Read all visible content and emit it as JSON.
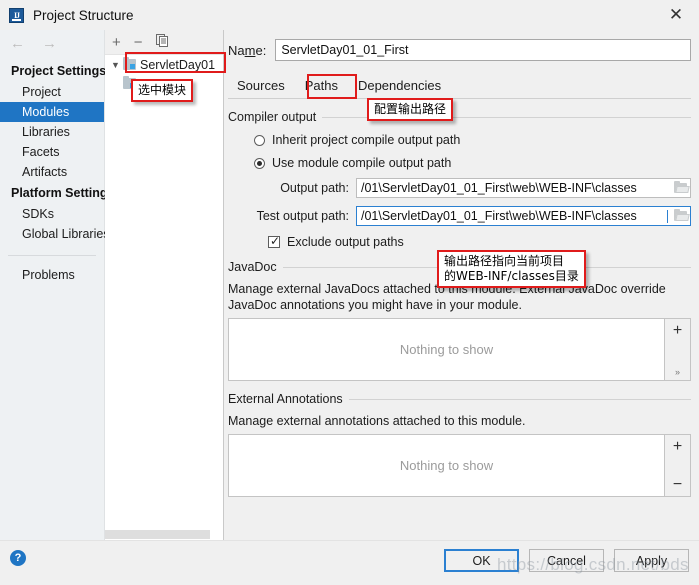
{
  "window": {
    "title": "Project Structure",
    "app_icon": "idea-icon",
    "close_icon": "✕"
  },
  "nav": {
    "back_icon": "←",
    "forward_icon": "→"
  },
  "sidebar": {
    "groups": [
      {
        "label": "Project Settings",
        "items": [
          {
            "label": "Project",
            "selected": false
          },
          {
            "label": "Modules",
            "selected": true
          },
          {
            "label": "Libraries",
            "selected": false
          },
          {
            "label": "Facets",
            "selected": false
          },
          {
            "label": "Artifacts",
            "selected": false
          }
        ]
      },
      {
        "label": "Platform Settings",
        "items": [
          {
            "label": "SDKs",
            "selected": false
          },
          {
            "label": "Global Libraries",
            "selected": false
          }
        ]
      }
    ],
    "problems_label": "Problems"
  },
  "tree": {
    "toolbar": {
      "add_label": "+",
      "remove_label": "−",
      "copy_label": "copy-icon"
    },
    "nodes": [
      {
        "label": "ServletDay01",
        "expanded": true,
        "selected": false
      }
    ]
  },
  "main": {
    "name_field": {
      "label": "Name:",
      "label_mnemonic": "m",
      "value": "ServletDay01_01_First"
    },
    "tabs": [
      {
        "label": "Sources",
        "active": false
      },
      {
        "label": "Paths",
        "active": true
      },
      {
        "label": "Dependencies",
        "active": false
      }
    ],
    "compiler_output": {
      "group_title": "Compiler output",
      "inherit_option": "Inherit project compile output path",
      "module_option": "Use module compile output path",
      "selected_option": "module",
      "output_path_label": "Output path:",
      "output_path_value": "/01\\ServletDay01_01_First\\web\\WEB-INF\\classes",
      "test_output_path_label": "Test output path:",
      "test_output_path_value": "/01\\ServletDay01_01_First\\web\\WEB-INF\\classes",
      "exclude_label": "Exclude output paths",
      "exclude_checked": true,
      "browse_icon": "folder-icon"
    },
    "javadoc": {
      "group_title": "JavaDoc",
      "description": "Manage external JavaDocs attached to this module. External JavaDoc override JavaDoc annotations you might have in your module.",
      "empty_text": "Nothing to show",
      "add_label": "+",
      "more_label": "»"
    },
    "external_annotations": {
      "group_title": "External Annotations",
      "description": "Manage external annotations attached to this module.",
      "empty_text": "Nothing to show",
      "add_label": "+",
      "remove_label": "−"
    }
  },
  "footer": {
    "help_label": "?",
    "ok_label": "OK",
    "cancel_label": "Cancel",
    "apply_label": "Apply"
  },
  "annotations": {
    "select_module": "选中模块",
    "configure_output_path": "配置输出路径",
    "output_path_note_line1": "输出路径指向当前项目",
    "output_path_note_line2": "的WEB-INF/classes目录"
  },
  "watermark": {
    "text": "https://blog.csdn.net/bds"
  },
  "colors": {
    "accent": "#1f75c4",
    "annotation_red": "#e01b1b",
    "focus_blue": "#2b80d1"
  }
}
